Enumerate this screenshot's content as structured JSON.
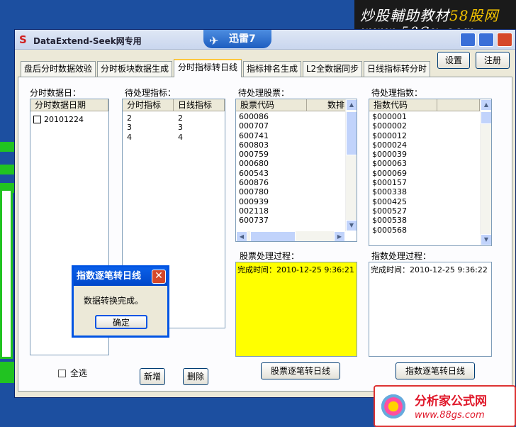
{
  "window": {
    "title": "DataExtend-Seek网专用",
    "badge": "迅雷7",
    "app_icon": "S"
  },
  "watermark_top": {
    "line1": "炒股輔助教材",
    "line1_accent": "58股网",
    "line2": "www.58Gu.com"
  },
  "watermark_bottom": {
    "line1": "分析家公式网",
    "line2": "www.88gs.com"
  },
  "header_buttons": {
    "settings": "设置",
    "register": "注册"
  },
  "tabs": [
    {
      "label": "盘后分时数据效验"
    },
    {
      "label": "分时板块数据生成"
    },
    {
      "label": "分时指标转日线"
    },
    {
      "label": "指标排名生成"
    },
    {
      "label": "L2全数据同步"
    },
    {
      "label": "日线指标转分时"
    }
  ],
  "active_tab": 2,
  "date_section": {
    "label": "分时数据日：",
    "column": "分时数据日期",
    "rows": [
      "20101224"
    ]
  },
  "indicator_section": {
    "label": "待处理指标：",
    "columns": [
      "分时指标",
      "日线指标"
    ],
    "rows": [
      [
        "2",
        "2"
      ],
      [
        "3",
        "3"
      ],
      [
        "4",
        "4"
      ]
    ],
    "add_button": "新增",
    "delete_button": "删除"
  },
  "stock_section": {
    "label": "待处理股票：",
    "columns": [
      "股票代码",
      "数排"
    ],
    "rows": [
      "600086",
      "000707",
      "600741",
      "600803",
      "000759",
      "000680",
      "600543",
      "600876",
      "000780",
      "000939",
      "002118",
      "600737"
    ],
    "process_label": "股票处理过程：",
    "process_log": "完成时间：2010-12-25 9:36:21",
    "convert_button": "股票逐笔转日线"
  },
  "index_section": {
    "label": "待处理指数：",
    "column": "指数代码",
    "rows": [
      "$000001",
      "$000002",
      "$000012",
      "$000024",
      "$000039",
      "$000063",
      "$000069",
      "$000157",
      "$000338",
      "$000425",
      "$000527",
      "$000538",
      "$000568"
    ],
    "process_label": "指数处理过程：",
    "process_log": "完成时间：2010-12-25 9:36:22",
    "convert_button": "指数逐笔转日线"
  },
  "select_all": {
    "label": "全选",
    "checked": false
  },
  "dialog": {
    "title": "指数逐笔转日线",
    "message": "数据转换完成。",
    "ok_button": "确定"
  },
  "colors": {
    "desktop": "#1c4fa0",
    "process_bg": "#ffff00",
    "dialog_title": "#0a5fe8"
  }
}
